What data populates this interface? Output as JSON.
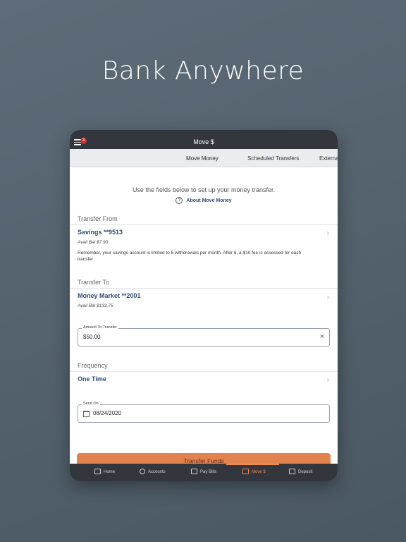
{
  "headline": "Bank Anywhere",
  "topbar": {
    "title": "Move $",
    "badge_count": "3"
  },
  "tabs": [
    {
      "label": "Move Money"
    },
    {
      "label": "Scheduled Transfers"
    },
    {
      "label": "Externa"
    }
  ],
  "intro": {
    "text": "Use the fields below to set up your money transfer.",
    "about_link": "About Move Money",
    "help_glyph": "?"
  },
  "transfer_from": {
    "label": "Transfer From",
    "account": "Savings **9513",
    "balance": "Avail Bal $7.90",
    "note": "Remember, your savings account is limited to 6 withdrawals per month. After 6, a $10 fee is assessed for each transfer"
  },
  "transfer_to": {
    "label": "Transfer To",
    "account": "Money Market **2001",
    "balance": "Avail Bal $133.75"
  },
  "amount": {
    "label": "Amount To Transfer",
    "value": "$50.00"
  },
  "frequency": {
    "label": "Frequency",
    "value": "One Time"
  },
  "send_on": {
    "label": "Send On",
    "value": "08/24/2020"
  },
  "cta": {
    "label": "Transfer Funds"
  },
  "bottom_nav": [
    {
      "label": "Home",
      "icon": "home-icon"
    },
    {
      "label": "Accounts",
      "icon": "dollar-icon"
    },
    {
      "label": "Pay Bills",
      "icon": "bill-icon"
    },
    {
      "label": "Move $",
      "icon": "move-money-icon"
    },
    {
      "label": "Deposit",
      "icon": "deposit-icon"
    }
  ],
  "colors": {
    "accent": "#e2834f",
    "nav_active": "#ee8a56",
    "dark_bar": "#33363d",
    "account_text": "#2e4d75"
  }
}
